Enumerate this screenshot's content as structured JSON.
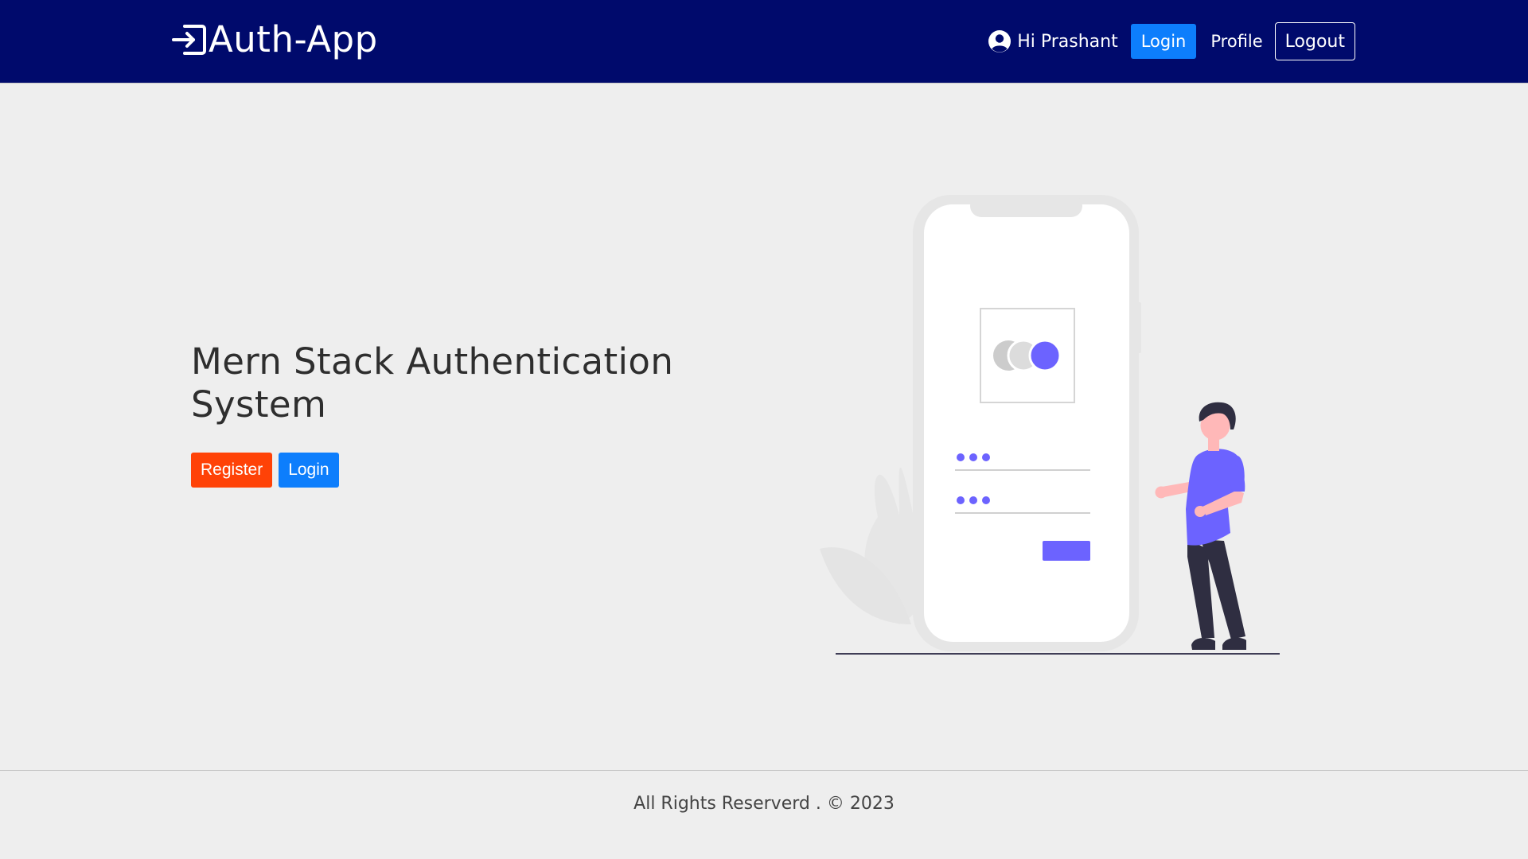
{
  "header": {
    "brand": "Auth-App",
    "brand_icon": "login-arrow-icon",
    "greeting": "Hi Prashant",
    "user_icon": "user-circle-icon",
    "nav": {
      "login_label": "Login",
      "profile_label": "Profile",
      "logout_label": "Logout"
    }
  },
  "hero": {
    "title": "Mern Stack Authentication System",
    "register_label": "Register",
    "login_label": "Login"
  },
  "footer": {
    "text": "All Rights Reserverd . © 2023"
  },
  "colors": {
    "navbar_bg": "#000a6c",
    "page_bg": "#eeeeee",
    "register": "#ff4207",
    "login": "#0d7efc",
    "accent": "#6c63ff"
  }
}
